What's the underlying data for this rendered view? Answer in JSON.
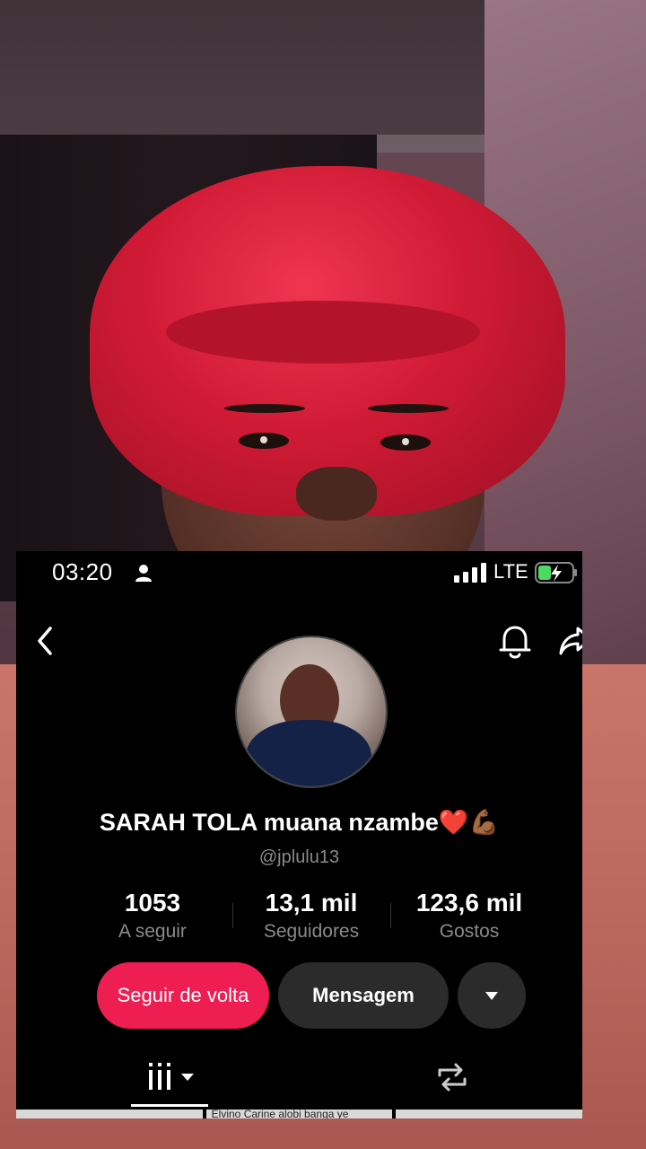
{
  "status_bar": {
    "time": "03:20",
    "network": "LTE",
    "icons": [
      "person-icon",
      "signal-icon",
      "battery-charging-icon"
    ]
  },
  "header": {
    "icons": [
      "back-icon",
      "bell-icon",
      "share-icon"
    ]
  },
  "profile": {
    "display_name": "SARAH TOLA muana nzambe❤️💪🏾",
    "handle": "@jplulu13"
  },
  "stats": [
    {
      "value": "1053",
      "label": "A seguir"
    },
    {
      "value": "13,1 mil",
      "label": "Seguidores"
    },
    {
      "value": "123,6 mil",
      "label": "Gostos"
    }
  ],
  "actions": {
    "follow_back": "Seguir de volta",
    "message": "Mensagem",
    "more_icon": "caret-down-icon"
  },
  "tabs": [
    "grid-icon",
    "repost-icon"
  ],
  "thumbnail_caption": "Elvino Carine alobi banga ye",
  "colors": {
    "follow_button": "#ee1d52",
    "secondary_button": "#2b2b2b",
    "background": "#000000",
    "muted_text": "#8a8a8a"
  }
}
